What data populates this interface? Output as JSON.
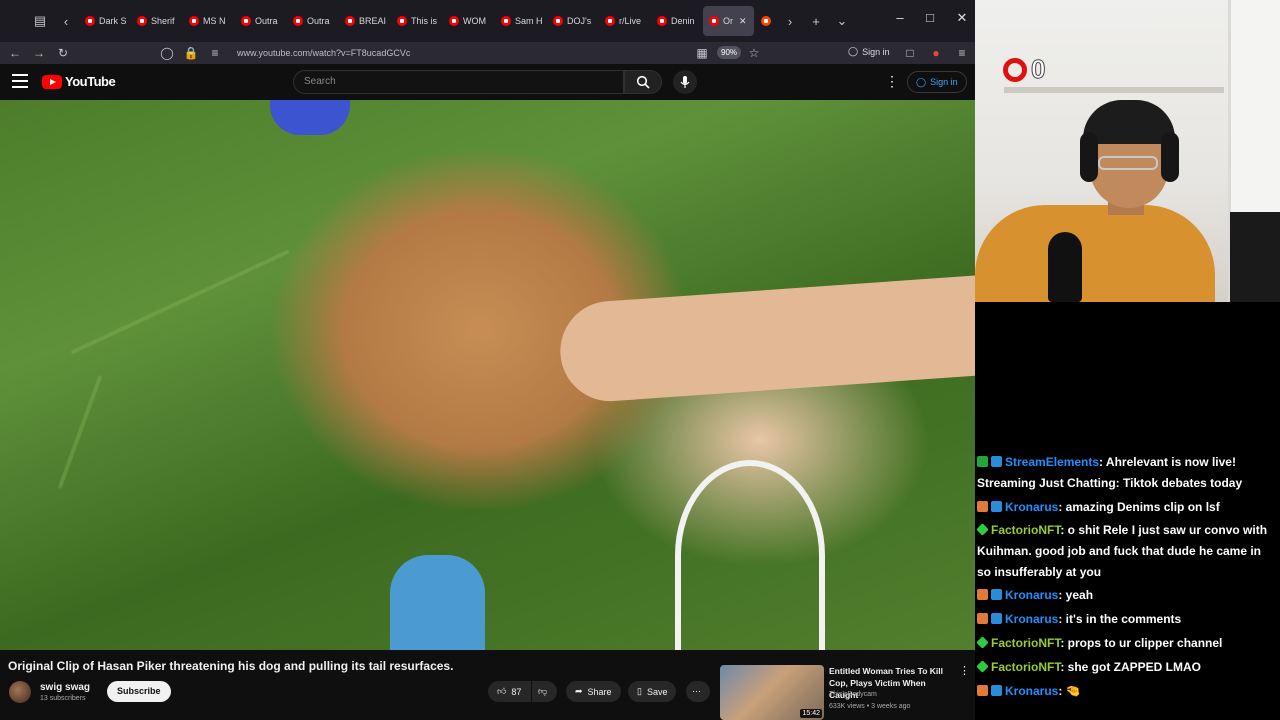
{
  "browser": {
    "tabs": [
      {
        "label": "Dark S",
        "active": false
      },
      {
        "label": "Sherif",
        "active": false
      },
      {
        "label": "MS N",
        "active": false
      },
      {
        "label": "Outra",
        "active": false
      },
      {
        "label": "Outra",
        "active": false
      },
      {
        "label": "BREAI",
        "active": false
      },
      {
        "label": "This is",
        "active": false
      },
      {
        "label": "WOM",
        "active": false
      },
      {
        "label": "Sam H",
        "active": false
      },
      {
        "label": "DOJ's",
        "active": false
      },
      {
        "label": "r/Live",
        "active": false
      },
      {
        "label": "Denin",
        "active": false
      },
      {
        "label": "Or",
        "active": true
      },
      {
        "label": "",
        "active": false
      }
    ],
    "url": "www.youtube.com/watch?v=FT8ucadGCVc",
    "zoom": "90%",
    "signin_label": "Sign in"
  },
  "youtube": {
    "logo_text": "YouTube",
    "search_placeholder": "Search",
    "signin_label": "Sign in",
    "video": {
      "title": "Original Clip of Hasan Piker threatening his dog and pulling its tail resurfaces.",
      "channel_name": "swig swag",
      "subscribers": "13 subscribers",
      "subscribe_label": "Subscribe",
      "likes": "87",
      "share_label": "Share",
      "save_label": "Save"
    },
    "recommended": {
      "title": "Entitled Woman Tries To Kill Cop, Plays Victim When Caught",
      "channel": "ThisIsBodycam",
      "meta": "633K views • 3 weeks ago",
      "duration": "15:42"
    }
  },
  "stream": {
    "counter": "0",
    "chat": [
      {
        "user": "StreamElements",
        "text": ": Ahrelevant is now live! Streaming Just Chatting: Tiktok debates today",
        "badge": "check",
        "user_color": "#1e90ff"
      },
      {
        "user": "Kronarus",
        "text": ": amazing Denims clip on lsf",
        "badge": "person",
        "user_color": "#1e90ff"
      },
      {
        "user": "FactorioNFT",
        "text": ": o shit Rele I just saw ur convo with Kuihman. good job and fuck that dude he came in so insufferably at you",
        "badge": "diamond",
        "user_color": "#9acd32"
      },
      {
        "user": "Kronarus",
        "text": ": yeah",
        "badge": "person",
        "user_color": "#1e90ff"
      },
      {
        "user": "Kronarus",
        "text": ": it's in the comments",
        "badge": "person",
        "user_color": "#1e90ff"
      },
      {
        "user": "FactorioNFT",
        "text": ": props to ur clipper channel",
        "badge": "diamond",
        "user_color": "#9acd32"
      },
      {
        "user": "FactorioNFT",
        "text": ": she got ZAPPED LMAO",
        "badge": "diamond",
        "user_color": "#9acd32"
      },
      {
        "user": "Kronarus",
        "text": ": 🤏",
        "badge": "person",
        "user_color": "#1e90ff"
      }
    ]
  },
  "colors": {
    "youtube_red": "#ff0000",
    "link_blue": "#3ea6ff",
    "chat_blue": "#1e90ff",
    "chat_green": "#9acd32"
  }
}
